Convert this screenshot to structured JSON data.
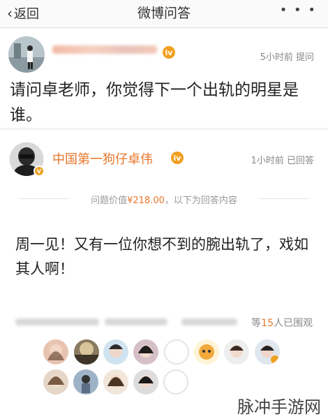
{
  "nav": {
    "back_label": "返回",
    "title": "微博问答",
    "more": "• • •"
  },
  "question": {
    "asker_badge": "iv",
    "time_text": "5小时前 提问",
    "text": "请问卓老师，你觉得下一个出轨的明星是谁。"
  },
  "answer": {
    "author": "中国第一狗仔卓伟",
    "author_badge": "iv",
    "verify_badge": "V",
    "time_text": "1小时前 已回答",
    "price_prefix": "问题价值",
    "price_amount": "¥218.00",
    "price_suffix": "，以下为回答内容",
    "text": "周一见！又有一位你想不到的腕出轨了，戏如其人啊！"
  },
  "onlookers": {
    "prefix": "等",
    "count": "15",
    "suffix": "人已围观"
  },
  "watermark": "脉冲手游网",
  "colors": {
    "accent": "#e8762a",
    "badge": "#f0a020"
  }
}
